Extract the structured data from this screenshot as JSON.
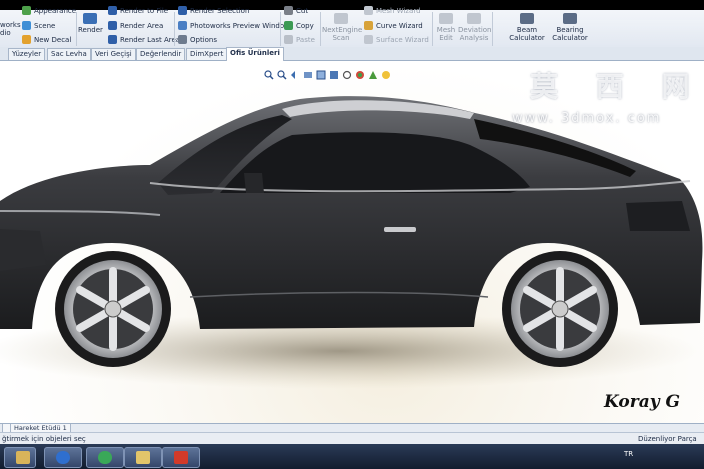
{
  "ribbon": {
    "groups": [
      {
        "items": [
          {
            "label": "Appearance",
            "icon": "appearance-icon"
          },
          {
            "label": "Scene",
            "icon": "scene-icon"
          },
          {
            "label": "New Decal",
            "icon": "decal-icon"
          }
        ]
      },
      {
        "items": [
          {
            "label": "Render",
            "icon": "render-icon"
          }
        ]
      },
      {
        "items": [
          {
            "label": "Render to File",
            "icon": "render-file-icon"
          },
          {
            "label": "Render Area",
            "icon": "render-area-icon"
          },
          {
            "label": "Render Last Area",
            "icon": "render-last-area-icon"
          }
        ]
      },
      {
        "items": [
          {
            "label": "Render Selection",
            "icon": "render-selection-icon"
          },
          {
            "label": "Photoworks Preview Window",
            "icon": "preview-window-icon"
          },
          {
            "label": "Options",
            "icon": "options-icon"
          }
        ]
      },
      {
        "items": [
          {
            "label": "Cut",
            "icon": "cut-icon"
          },
          {
            "label": "Copy",
            "icon": "copy-icon"
          },
          {
            "label": "Paste",
            "icon": "paste-icon"
          }
        ]
      },
      {
        "items": [
          {
            "label": "NextEngine Scan",
            "icon": "scan-icon"
          }
        ]
      },
      {
        "items": [
          {
            "label": "Mesh Wizard",
            "icon": "mesh-wizard-icon"
          },
          {
            "label": "Curve Wizard",
            "icon": "curve-wizard-icon"
          },
          {
            "label": "Surface Wizard",
            "icon": "surface-wizard-icon"
          }
        ]
      },
      {
        "items": [
          {
            "label": "Mesh Edit",
            "icon": "mesh-edit-icon"
          },
          {
            "label": "Deviation Analysis",
            "icon": "deviation-icon"
          }
        ]
      },
      {
        "items": [
          {
            "label": "Beam Calculator",
            "icon": "beam-calculator-icon"
          },
          {
            "label": "Bearing Calculator",
            "icon": "bearing-calculator-icon"
          }
        ]
      }
    ],
    "left_cut_label": "works\ndio"
  },
  "tabs": [
    "Yüzeyler",
    "Sac Levha",
    "Veri Geçişi",
    "Değerlendir",
    "DimXpert",
    "Ofis Ürünleri"
  ],
  "active_tab": "Ofis Ürünleri",
  "viewport": {
    "signature": "Koray G",
    "watermark": "莫 西 网",
    "watermark_url": "www. 3dmox. com"
  },
  "bottom_tabs": [
    "Hareket Etüdü 1"
  ],
  "status": {
    "left": "ğtirmek için objeleri seç",
    "right": "Düzenliyor Parça"
  },
  "taskbar": {
    "lang": "TR"
  },
  "colors": {
    "car_body": "#3a3b3e",
    "ribbon_bg": "#e9eef5",
    "taskbar": "#1b2740",
    "accent": "#1c2a44"
  }
}
